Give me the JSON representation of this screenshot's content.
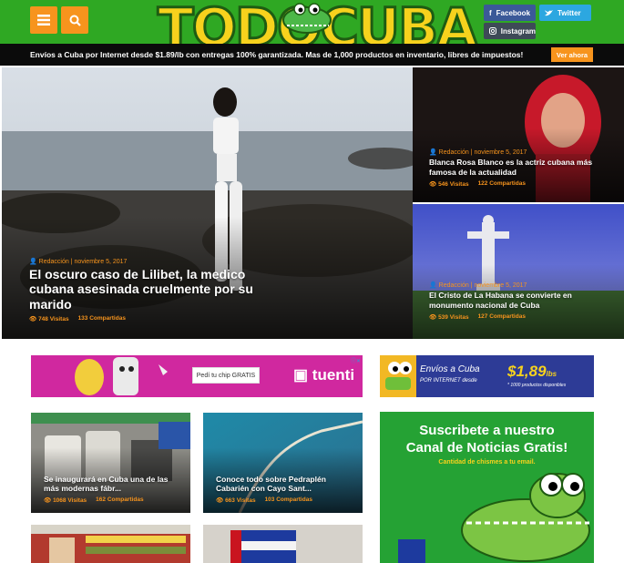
{
  "header": {
    "logo_text": "TODOCUBA",
    "social": {
      "facebook_label": "Facebook",
      "twitter_label": "Twitter",
      "instagram_label": "Instagram"
    },
    "menu_icon": "hamburger-icon",
    "search_icon": "search-icon"
  },
  "promo": {
    "text": "Envíos a Cuba por Internet desde $1.89/lb con entregas 100% garantizada. Mas de 1,000 productos en inventario, libres de impuestos!",
    "button_label": "Ver ahora"
  },
  "hero_main": {
    "author": "Redacción | noviembre 5, 2017",
    "title": "El oscuro caso de Lilibet, la medico cubana asesinada cruelmente por su marido",
    "visits": "748 Visitas",
    "shares": "133 Compartidas"
  },
  "hero_top_right": {
    "author": "Redacción | noviembre 5, 2017",
    "title": "Blanca Rosa Blanco es la actriz cubana más famosa de la actualidad",
    "visits": "546 Visitas",
    "shares": "122 Compartidas"
  },
  "hero_bottom_right": {
    "author": "Redacción | noviembre 5, 2017",
    "title": "El Cristo de La Habana se convierte en monumento nacional de Cuba",
    "visits": "539 Visitas",
    "shares": "127 Compartidas"
  },
  "ad_tuenti": {
    "button_label": "Pedí tu chip GRATIS",
    "logo_text": "tuenti"
  },
  "ad_envios": {
    "main_text": "Envíos a Cuba",
    "sub_text": "POR INTERNET desde",
    "price": "$1,89",
    "unit": "lbs",
    "small_text": "* 1000 productos disponibles"
  },
  "cards": [
    {
      "title": "Se inaugurará en Cuba una de las más modernas fábr...",
      "visits": "1068 Visitas",
      "shares": "162 Compartidas"
    },
    {
      "title": "Conoce todo sobre Pedraplén Cabarién con Cayo Sant...",
      "visits": "663 Visitas",
      "shares": "103 Compartidas"
    }
  ],
  "subscribe": {
    "title_line1": "Suscribete a nuestro",
    "title_line2": "Canal de Noticias Gratis!",
    "tagline": "Cantidad de chismes a tu email."
  },
  "colors": {
    "brand_green": "#2fa823",
    "accent_orange": "#f7941d",
    "facebook": "#3b5998",
    "twitter": "#2ca7e0",
    "instagram": "#3e4a57",
    "tuenti_magenta": "#d0289f"
  }
}
